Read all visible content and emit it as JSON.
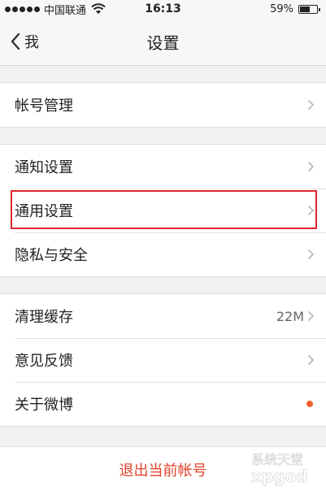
{
  "status_bar": {
    "carrier": "中国联通",
    "time": "16:13",
    "battery_percent_label": "59%",
    "battery_level": 0.59
  },
  "nav": {
    "back_label": "我",
    "title": "设置"
  },
  "groups": [
    {
      "rows": [
        {
          "label": "帐号管理"
        }
      ]
    },
    {
      "rows": [
        {
          "label": "通知设置"
        },
        {
          "label": "通用设置",
          "highlighted": true
        },
        {
          "label": "隐私与安全"
        }
      ]
    },
    {
      "rows": [
        {
          "label": "清理缓存",
          "value": "22M"
        },
        {
          "label": "意见反馈"
        },
        {
          "label": "关于微博",
          "badge": "new-dot"
        }
      ]
    }
  ],
  "logout_label": "退出当前帐号",
  "colors": {
    "highlight_border": "#e0252f",
    "logout_text": "#e2422a",
    "badge_dot": "#f4622c"
  },
  "watermark": {
    "text": "系统天堂",
    "sub": "xpgod"
  }
}
